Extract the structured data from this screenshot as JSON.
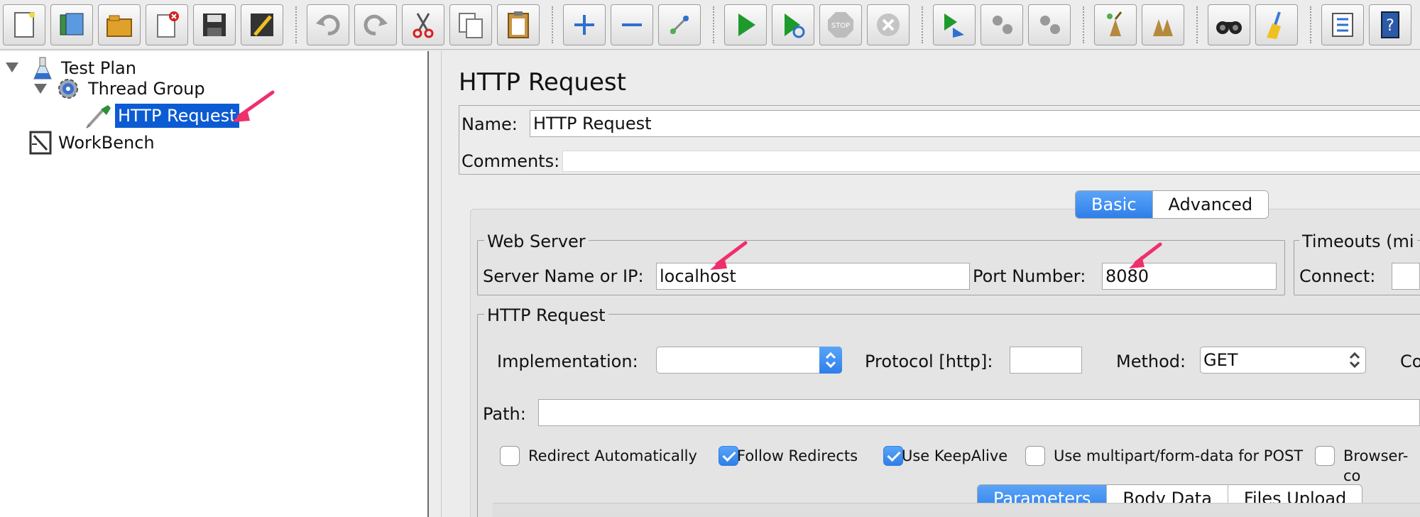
{
  "toolbar": {
    "icons": [
      "new-icon",
      "templates-icon",
      "open-icon",
      "close-icon",
      "save-icon",
      "save-as-icon",
      "undo-icon",
      "redo-icon",
      "cut-icon",
      "copy-icon",
      "paste-icon",
      "expand-icon",
      "collapse-icon",
      "toggle-icon",
      "start-icon",
      "start-no-pauses-icon",
      "stop-icon",
      "shutdown-icon",
      "remote-start-icon",
      "remote-stop-icon",
      "remote-shutdown-icon",
      "clear-icon",
      "clear-all-icon",
      "search-icon",
      "reset-search-icon",
      "function-helper-icon",
      "help-icon"
    ]
  },
  "tree": {
    "nodes": [
      {
        "label": "Test Plan",
        "icon": "flask-icon"
      },
      {
        "label": "Thread Group",
        "icon": "gear-icon"
      },
      {
        "label": "HTTP Request",
        "icon": "pipette-icon"
      },
      {
        "label": "WorkBench",
        "icon": "workbench-icon"
      }
    ]
  },
  "form": {
    "title": "HTTP Request",
    "name_label": "Name:",
    "name_value": "HTTP Request",
    "comments_label": "Comments:",
    "comments_value": "",
    "tabs": [
      "Basic",
      "Advanced"
    ],
    "web_server": {
      "title": "Web Server",
      "server_label": "Server Name or IP:",
      "server_value": "localhost",
      "port_label": "Port Number:",
      "port_value": "8080"
    },
    "timeouts": {
      "title": "Timeouts (mi",
      "connect_label": "Connect:"
    },
    "http_request": {
      "title": "HTTP Request",
      "implementation_label": "Implementation:",
      "implementation_value": "",
      "protocol_label": "Protocol [http]:",
      "protocol_value": "",
      "method_label": "Method:",
      "method_value": "GET",
      "content_label": "Co",
      "path_label": "Path:",
      "path_value": ""
    },
    "checkboxes": [
      {
        "label": "Redirect Automatically",
        "checked": false
      },
      {
        "label": "Follow Redirects",
        "checked": true
      },
      {
        "label": "Use KeepAlive",
        "checked": true
      },
      {
        "label": "Use multipart/form-data for POST",
        "checked": false
      },
      {
        "label": "Browser-co",
        "checked": false
      }
    ],
    "bottom_tabs": [
      "Parameters",
      "Body Data",
      "Files Upload"
    ]
  },
  "colors": {
    "selection": "#0b5bd3",
    "accent": "#2f7fe9",
    "annotation_arrow": "#ef2f6b"
  }
}
